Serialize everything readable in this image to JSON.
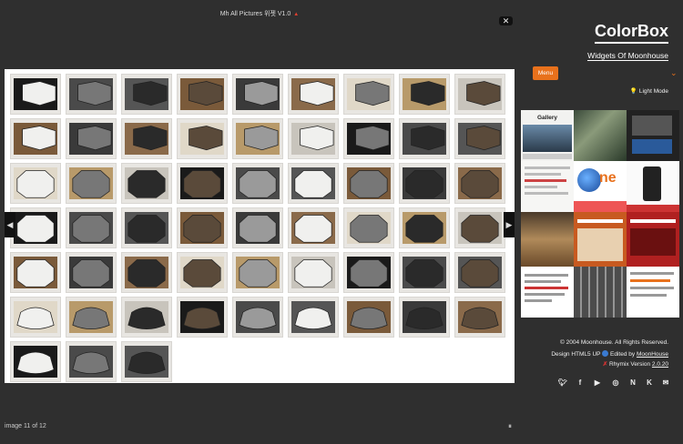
{
  "window": {
    "title": "Mh All Pictures 위젯 V1.0"
  },
  "lightbox": {
    "status": "image 11 of 12",
    "close_icon": "close-icon",
    "prev_icon": "chevron-left-icon",
    "next_icon": "chevron-right-icon",
    "thumb_rows": [
      9,
      9,
      9,
      9,
      9,
      9,
      3
    ]
  },
  "sidebar": {
    "logo": "ColorBox",
    "subtitle": "Widgets Of Moonhouse",
    "menu_label": "Menu",
    "light_mode_label": "Light Mode",
    "collage_caption": "Gallery",
    "footer": {
      "copyright": "© 2004 Moonhouse. All Rights Reserved.",
      "design_prefix": "Design HTML5 UP",
      "edited_prefix": "Edited by",
      "edited_by": "MoonHouse",
      "rhymix_prefix": "Rhymix Version",
      "rhymix_version": "2.0.20"
    },
    "social": [
      "twitter-icon",
      "facebook-icon",
      "youtube-icon",
      "instagram-icon",
      "naver-icon",
      "kakao-icon",
      "email-icon"
    ]
  },
  "colors": {
    "background": "#2f2f2f",
    "accent": "#e8711c",
    "gallery_bg": "#ffffff"
  }
}
